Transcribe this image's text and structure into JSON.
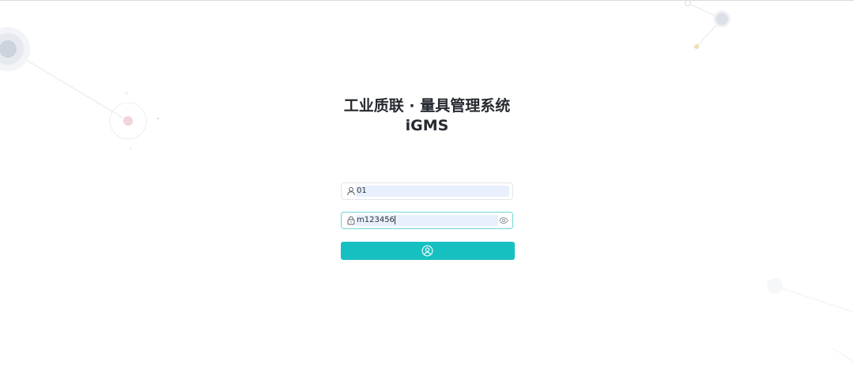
{
  "header": {
    "title_line1": "工业质联 · 量具管理系统",
    "title_line2": "iGMS"
  },
  "login_form": {
    "username_value": "01",
    "password_value": "m123456",
    "username_icon": "user-icon",
    "password_icon": "lock-icon",
    "password_toggle_icon": "eye-icon",
    "submit_icon": "user-circle-icon"
  },
  "colors": {
    "accent": "#17c0c0",
    "autofill_bg": "#e8f0fe",
    "focus_border": "#6fd4d4",
    "title_text": "#262a30"
  }
}
